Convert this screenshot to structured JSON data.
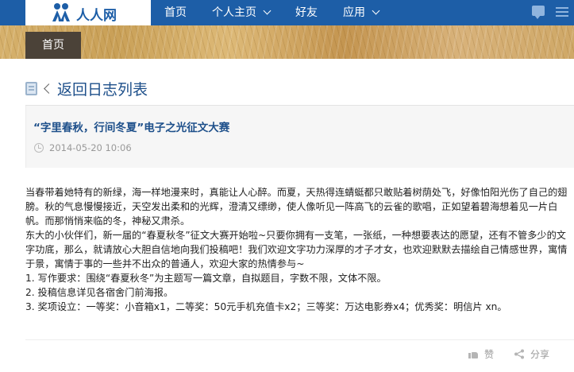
{
  "site": {
    "logo_text": "人人网"
  },
  "nav": {
    "items": [
      {
        "label": "首页",
        "has_dropdown": false
      },
      {
        "label": "个人主页",
        "has_dropdown": true
      },
      {
        "label": "好友",
        "has_dropdown": false
      },
      {
        "label": "应用",
        "has_dropdown": true
      }
    ],
    "right_icons": [
      "message-icon",
      "menu-icon"
    ]
  },
  "banner": {
    "home_tab": "首页"
  },
  "blog": {
    "back_label": "返回日志列表",
    "title": "“字里春秋，行间冬夏”电子之光征文大赛",
    "date": "2014-05-20 10:06",
    "paragraphs": [
      "当春带着她特有的新绿，海一样地漫来时，真能让人心醉。而夏，天热得连蜻蜓都只敢贴着树荫处飞，好像怕阳光伤了自己的翅膀。秋的气息慢慢接近，天空发出柔和的光辉，澄清又缥缈，使人像听见一阵高飞的云雀的歌唱，正如望着碧海想着见一片白帆。而那悄悄来临的冬，神秘又肃杀。",
      "东大的小伙伴们，新一届的“春夏秋冬”征文大赛开始啦~只要你拥有一支笔，一张纸，一种想要表达的愿望，还有不管多少的文字功底，那么，就请放心大胆自信地向我们投稿吧！我们欢迎文字功力深厚的才子才女，也欢迎默默去描绘自己情感世界，寓情于景，寓情于事的一些并不出众的普通人，欢迎大家的热情参与~",
      "1. 写作要求：围绕“春夏秋冬”为主题写一篇文章，自拟题目，字数不限，文体不限。",
      "2. 投稿信息详见各宿舍门前海报。",
      "3. 奖项设立：一等奖：小音箱x1，二等奖：50元手机充值卡x2；三等奖：万达电影券x4；优秀奖：明信片 xn。"
    ],
    "like_label": "赞",
    "share_label": "分享"
  },
  "colors": {
    "nav_bg": "#1d5ea7",
    "title_blue": "#1d4f8a",
    "home_tab_bg": "#4b4238"
  }
}
